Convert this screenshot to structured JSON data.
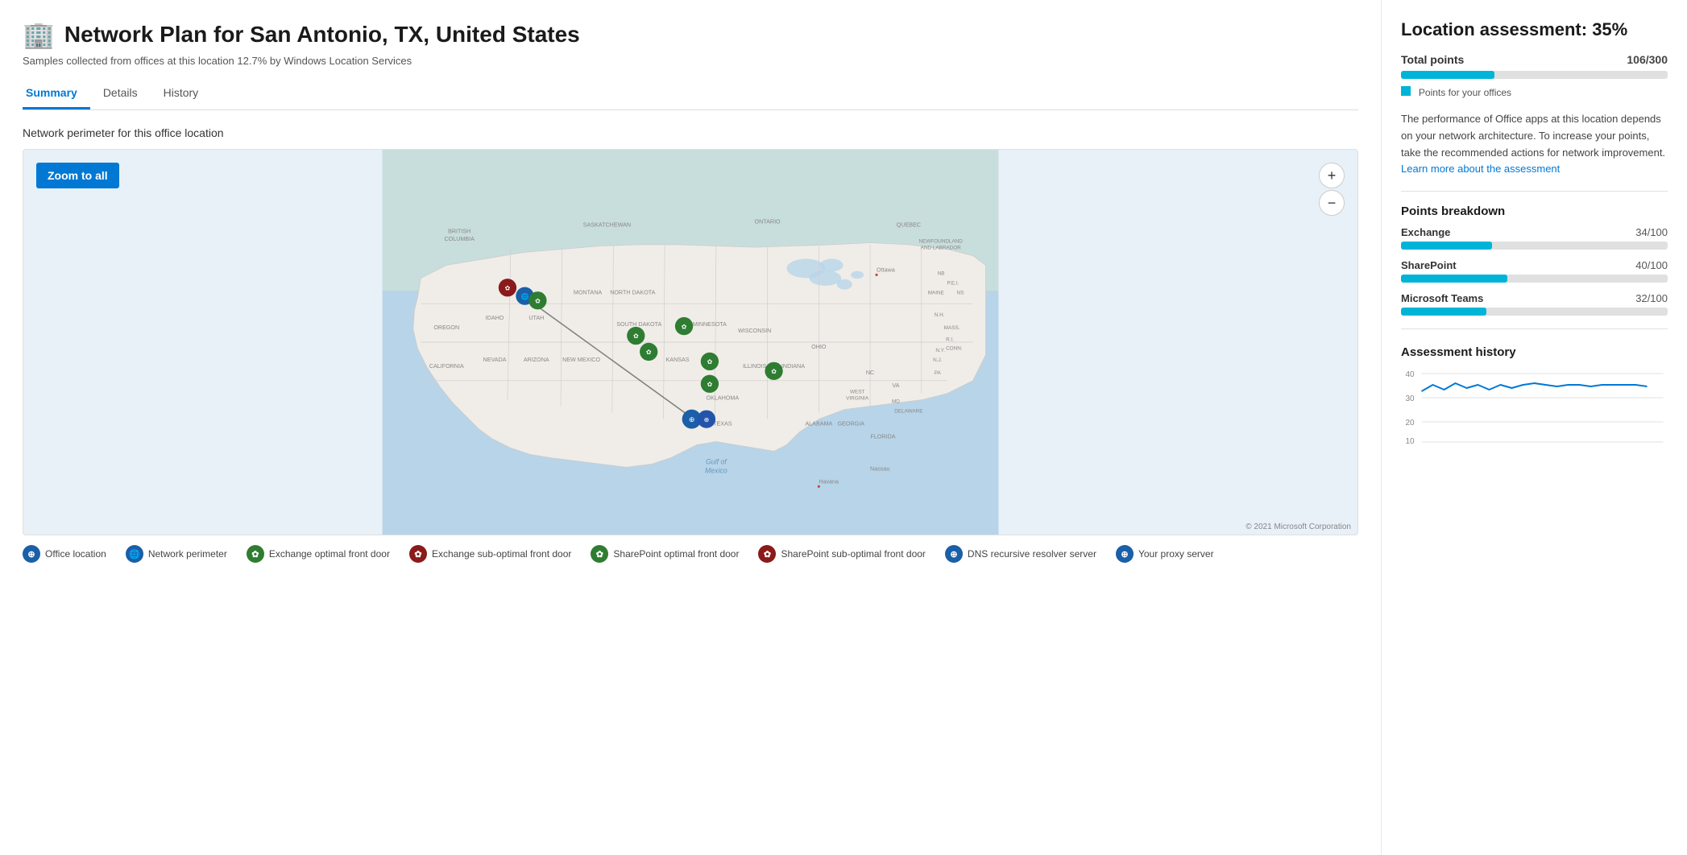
{
  "page": {
    "title": "Network Plan for San Antonio, TX, United States",
    "title_icon": "🏢",
    "subtitle": "Samples collected from offices at this location 12.7% by Windows Location Services"
  },
  "tabs": [
    {
      "id": "summary",
      "label": "Summary",
      "active": true
    },
    {
      "id": "details",
      "label": "Details",
      "active": false
    },
    {
      "id": "history",
      "label": "History",
      "active": false
    }
  ],
  "map": {
    "section_label": "Network perimeter for this office location",
    "zoom_btn": "Zoom to all",
    "zoom_in_icon": "+",
    "zoom_out_icon": "−",
    "copyright": "© 2021 Microsoft Corporation"
  },
  "legend": [
    {
      "id": "office-location",
      "label": "Office location",
      "color": "#1a5fa8",
      "symbol": "⊕"
    },
    {
      "id": "network-perimeter",
      "label": "Network perimeter",
      "color": "#1a5fa8",
      "symbol": "🌐"
    },
    {
      "id": "exchange-optimal",
      "label": "Exchange optimal front door",
      "color": "#2e7d32",
      "symbol": "✿"
    },
    {
      "id": "exchange-suboptimal",
      "label": "Exchange sub-optimal front door",
      "color": "#8b1a1a",
      "symbol": "✿"
    },
    {
      "id": "sharepoint-optimal",
      "label": "SharePoint optimal front door",
      "color": "#2e7d32",
      "symbol": "✿"
    },
    {
      "id": "sharepoint-suboptimal",
      "label": "SharePoint sub-optimal front door",
      "color": "#8b1a1a",
      "symbol": "✿"
    },
    {
      "id": "dns-recursive",
      "label": "DNS recursive resolver server",
      "color": "#1a5fa8",
      "symbol": "⊕"
    },
    {
      "id": "proxy-server",
      "label": "Your proxy server",
      "color": "#1a5fa8",
      "symbol": "⊕"
    }
  ],
  "assessment": {
    "title": "Location assessment: 35%",
    "total_points_label": "Total points",
    "total_points_value": "106/300",
    "total_points_pct": 35,
    "legend_color_label": "Points for your offices",
    "description": "The performance of Office apps at this location depends on your network architecture. To increase your points, take the recommended actions for network improvement.",
    "learn_more_text": "Learn more about the assessment",
    "breakdown_title": "Points breakdown",
    "breakdown": [
      {
        "label": "Exchange",
        "score": "34/100",
        "pct": 34
      },
      {
        "label": "SharePoint",
        "score": "40/100",
        "pct": 40
      },
      {
        "label": "Microsoft Teams",
        "score": "32/100",
        "pct": 32
      }
    ],
    "history_title": "Assessment history",
    "history_labels": [
      "40",
      "30",
      "20",
      "10"
    ],
    "history_data": [
      32,
      35,
      33,
      36,
      34,
      35,
      33,
      35,
      34,
      35,
      36,
      35,
      34,
      35,
      35,
      35,
      34,
      35,
      35,
      35,
      34
    ]
  }
}
